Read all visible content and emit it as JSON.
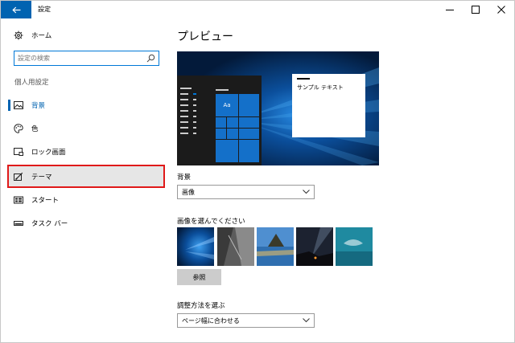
{
  "window": {
    "title": "設定"
  },
  "sidebar": {
    "home_label": "ホーム",
    "search_placeholder": "設定の検索",
    "section_label": "個人用設定",
    "items": [
      {
        "label": "背景",
        "icon": "picture-icon"
      },
      {
        "label": "色",
        "icon": "palette-icon"
      },
      {
        "label": "ロック画面",
        "icon": "lock-screen-icon"
      },
      {
        "label": "テーマ",
        "icon": "theme-icon"
      },
      {
        "label": "スタート",
        "icon": "start-icon"
      },
      {
        "label": "タスク バー",
        "icon": "taskbar-icon"
      }
    ]
  },
  "main": {
    "title": "プレビュー",
    "preview_sample_text": "サンプル テキスト",
    "preview_tile_text": "Aa",
    "background_label": "背景",
    "background_value": "画像",
    "choose_picture_label": "画像を選んでください",
    "browse_label": "参照",
    "fit_label": "調整方法を選ぶ",
    "fit_value": "ページ幅に合わせる"
  },
  "colors": {
    "accent": "#0063b1",
    "highlight_border": "#e01919"
  }
}
